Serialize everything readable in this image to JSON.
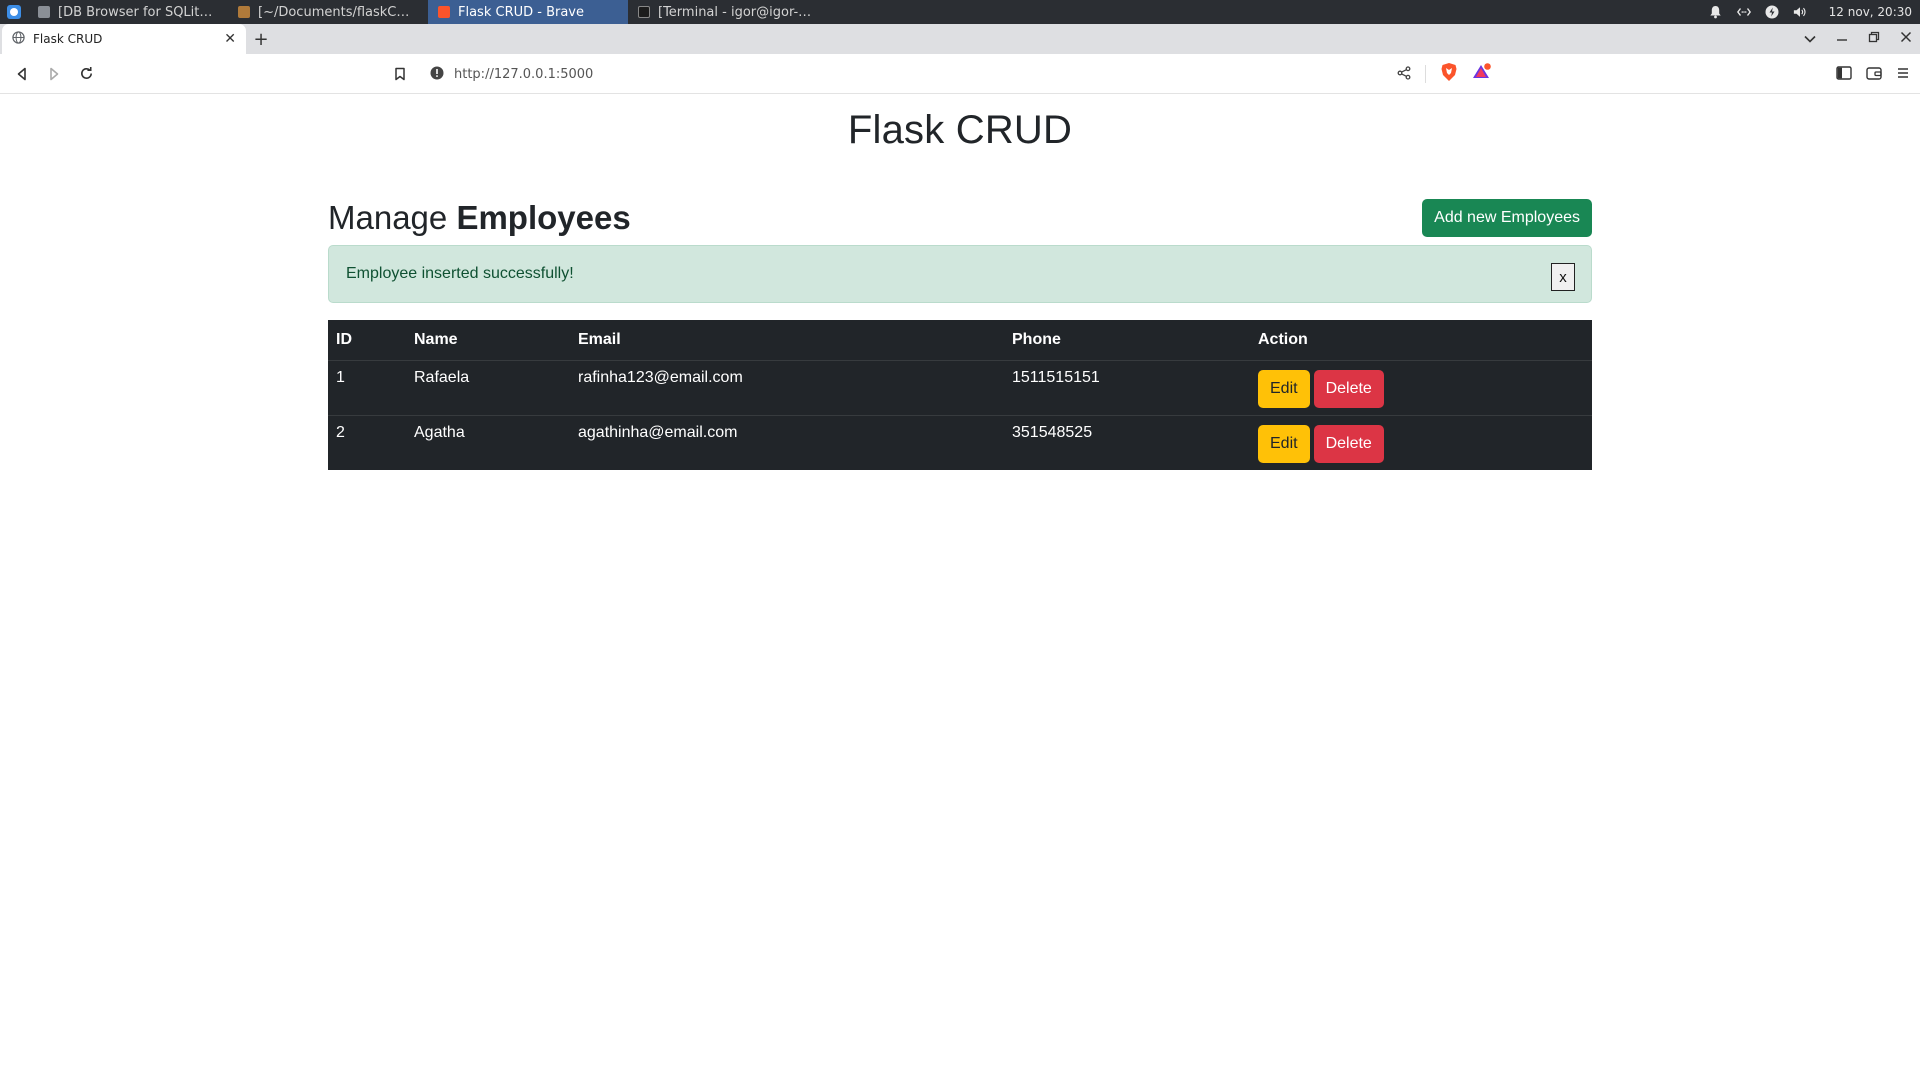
{
  "taskbar": {
    "tasks": [
      {
        "label": "[DB Browser for SQLite - /ho...",
        "active": false
      },
      {
        "label": "[~/Documents/flaskCRUDap...",
        "active": false
      },
      {
        "label": "Flask CRUD - Brave",
        "active": true
      },
      {
        "label": "[Terminal - igor@igor-STI: ~/...",
        "active": false
      }
    ],
    "clock": "12 nov, 20:30"
  },
  "browser": {
    "tab_title": "Flask CRUD",
    "url": "http://127.0.0.1:5000"
  },
  "page": {
    "site_title": "Flask CRUD",
    "heading_light": "Manage ",
    "heading_bold": "Employees",
    "add_button": "Add new Employees",
    "alert_text": "Employee inserted successfully!",
    "alert_close": "x",
    "table": {
      "headers": [
        "ID",
        "Name",
        "Email",
        "Phone",
        "Action"
      ],
      "rows": [
        {
          "id": "1",
          "name": "Rafaela",
          "email": "rafinha123@email.com",
          "phone": "1511515151"
        },
        {
          "id": "2",
          "name": "Agatha",
          "email": "agathinha@email.com",
          "phone": "351548525"
        }
      ],
      "edit_label": "Edit",
      "delete_label": "Delete"
    }
  },
  "colors": {
    "success": "#198754",
    "warning": "#ffc107",
    "danger": "#dc3545",
    "table_dark": "#212529",
    "alert_bg": "#d1e7dd",
    "brave_orange": "#fb542b"
  }
}
